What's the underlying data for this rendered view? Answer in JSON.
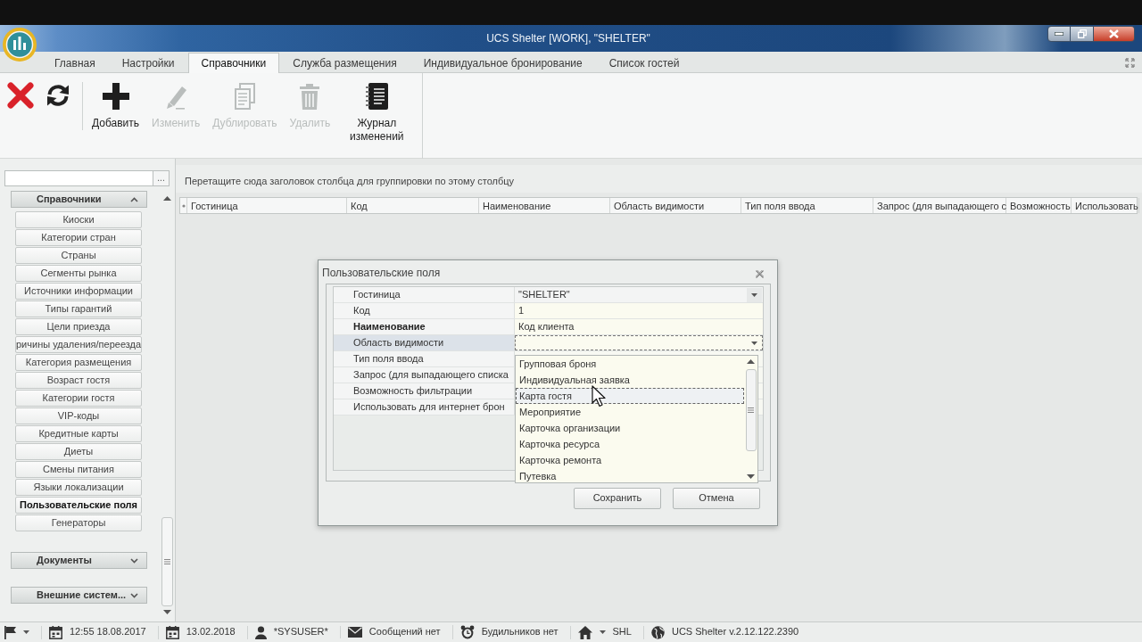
{
  "window": {
    "title": "UCS Shelter [WORK], \"SHELTER\""
  },
  "ribbon_tabs": [
    {
      "label": "Главная",
      "selected": false
    },
    {
      "label": "Настройки",
      "selected": false
    },
    {
      "label": "Справочники",
      "selected": true
    },
    {
      "label": "Служба размещения",
      "selected": false
    },
    {
      "label": "Индивидуальное бронирование",
      "selected": false
    },
    {
      "label": "Список гостей",
      "selected": false
    }
  ],
  "toolbar": {
    "buttons": [
      {
        "label": "Добавить",
        "disabled": false
      },
      {
        "label": "Изменить",
        "disabled": true
      },
      {
        "label": "Дублировать",
        "disabled": true
      },
      {
        "label": "Удалить",
        "disabled": true
      },
      {
        "label": "Журнал изменений",
        "disabled": false
      }
    ]
  },
  "sidebar": {
    "browse_button": "...",
    "groups": [
      {
        "label": "Справочники",
        "expanded": true,
        "items": [
          {
            "label": "Киоски",
            "selected": false
          },
          {
            "label": "Категории стран",
            "selected": false
          },
          {
            "label": "Страны",
            "selected": false
          },
          {
            "label": "Сегменты рынка",
            "selected": false
          },
          {
            "label": "Источники информации",
            "selected": false
          },
          {
            "label": "Типы гарантий",
            "selected": false
          },
          {
            "label": "Цели приезда",
            "selected": false
          },
          {
            "label": "ричины удаления/переезда",
            "selected": false
          },
          {
            "label": "Категория размещения",
            "selected": false
          },
          {
            "label": "Возраст гостя",
            "selected": false
          },
          {
            "label": "Категории гостя",
            "selected": false
          },
          {
            "label": "VIP-коды",
            "selected": false
          },
          {
            "label": "Кредитные карты",
            "selected": false
          },
          {
            "label": "Диеты",
            "selected": false
          },
          {
            "label": "Смены питания",
            "selected": false
          },
          {
            "label": "Языки локализации",
            "selected": false
          },
          {
            "label": "Пользовательские поля",
            "selected": true
          },
          {
            "label": "Генераторы",
            "selected": false
          }
        ]
      },
      {
        "label": "Документы",
        "expanded": false
      },
      {
        "label": "Внешние систем...",
        "expanded": false
      }
    ]
  },
  "grid": {
    "group_panel_hint": "Перетащите сюда заголовок столбца для группировки по этому столбцу",
    "columns": [
      "Гостиница",
      "Код",
      "Наименование",
      "Область видимости",
      "Тип поля ввода",
      "Запрос (для выпадающего с",
      "Возможность",
      "Использовать"
    ]
  },
  "dialog": {
    "title": "Пользовательские поля",
    "properties": [
      {
        "label": "Гостиница",
        "kind": "combo",
        "value": "\"SHELTER\"",
        "expanded": false,
        "required": false,
        "selected": false
      },
      {
        "label": "Код",
        "kind": "text",
        "value": "1",
        "required": false,
        "selected": false
      },
      {
        "label": "Наименование",
        "kind": "text",
        "value": "Код клиента",
        "required": true,
        "selected": false
      },
      {
        "label": "Область видимости",
        "kind": "combo",
        "expanded": true,
        "required": false,
        "selected": true,
        "options": [
          {
            "label": "Групповая броня",
            "selected": false
          },
          {
            "label": "Индивидуальная заявка",
            "selected": false
          },
          {
            "label": "Карта гостя",
            "selected": true
          },
          {
            "label": "Мероприятие",
            "selected": false
          },
          {
            "label": "Карточка организации",
            "selected": false
          },
          {
            "label": "Карточка ресурса",
            "selected": false
          },
          {
            "label": "Карточка ремонта",
            "selected": false
          },
          {
            "label": "Путевка",
            "selected": false
          }
        ]
      },
      {
        "label": "Тип поля ввода",
        "required": false,
        "selected": false
      },
      {
        "label": "Запрос (для выпадающего списка",
        "required": false,
        "selected": false
      },
      {
        "label": "Возможность фильтрации",
        "required": false,
        "selected": false
      },
      {
        "label": "Использовать для интернет брон",
        "required": false,
        "selected": false
      }
    ],
    "buttons": [
      "Сохранить",
      "Отмена"
    ]
  },
  "status_bar": {
    "items": [
      {
        "text": "12:55 18.08.2017"
      },
      {
        "text": "13.02.2018"
      },
      {
        "text": "*SYSUSER*"
      },
      {
        "text": "Сообщений нет"
      },
      {
        "text": "Будильников нет"
      },
      {
        "text": "SHL"
      },
      {
        "text": "UCS Shelter v.2.12.122.2390"
      }
    ]
  }
}
